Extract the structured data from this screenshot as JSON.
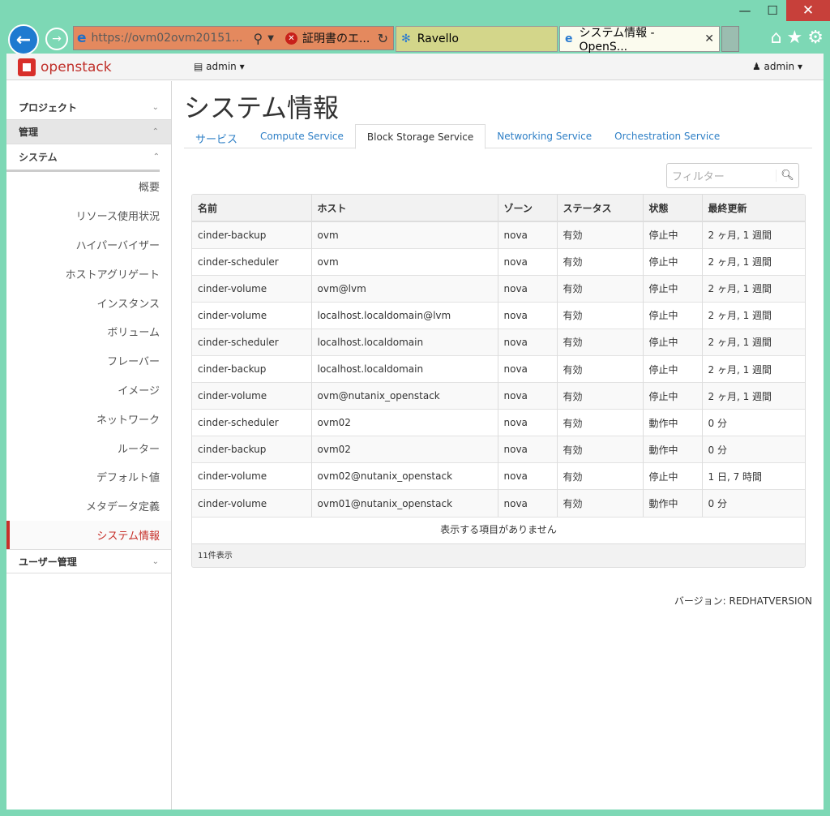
{
  "browser": {
    "address_url": "https://ovm02ovm20151...",
    "cert_error": "証明書のエ...",
    "tabs": [
      {
        "label": "Ravello"
      },
      {
        "label": "システム情報 - OpenS..."
      }
    ],
    "minimize": "—",
    "maximize": "☐",
    "close": "✕"
  },
  "topnav": {
    "brand": "openstack",
    "project": "admin",
    "user": "admin"
  },
  "sidebar": {
    "project_label": "プロジェクト",
    "admin_label": "管理",
    "system_label": "システム",
    "items": [
      "概要",
      "リソース使用状況",
      "ハイパーバイザー",
      "ホストアグリゲート",
      "インスタンス",
      "ボリューム",
      "フレーバー",
      "イメージ",
      "ネットワーク",
      "ルーター",
      "デフォルト値",
      "メタデータ定義",
      "システム情報"
    ],
    "user_mgmt_label": "ユーザー管理"
  },
  "main": {
    "title": "システム情報",
    "tabs": [
      "サービス",
      "Compute Service",
      "Block Storage Service",
      "Networking Service",
      "Orchestration Service"
    ],
    "filter_placeholder": "フィルター",
    "headers": [
      "名前",
      "ホスト",
      "ゾーン",
      "ステータス",
      "状態",
      "最終更新"
    ],
    "rows": [
      [
        "cinder-backup",
        "ovm",
        "nova",
        "有効",
        "停止中",
        "2 ヶ月, 1 週間"
      ],
      [
        "cinder-scheduler",
        "ovm",
        "nova",
        "有効",
        "停止中",
        "2 ヶ月, 1 週間"
      ],
      [
        "cinder-volume",
        "ovm@lvm",
        "nova",
        "有効",
        "停止中",
        "2 ヶ月, 1 週間"
      ],
      [
        "cinder-volume",
        "localhost.localdomain@lvm",
        "nova",
        "有効",
        "停止中",
        "2 ヶ月, 1 週間"
      ],
      [
        "cinder-scheduler",
        "localhost.localdomain",
        "nova",
        "有効",
        "停止中",
        "2 ヶ月, 1 週間"
      ],
      [
        "cinder-backup",
        "localhost.localdomain",
        "nova",
        "有効",
        "停止中",
        "2 ヶ月, 1 週間"
      ],
      [
        "cinder-volume",
        "ovm@nutanix_openstack",
        "nova",
        "有効",
        "停止中",
        "2 ヶ月, 1 週間"
      ],
      [
        "cinder-scheduler",
        "ovm02",
        "nova",
        "有効",
        "動作中",
        "0 分"
      ],
      [
        "cinder-backup",
        "ovm02",
        "nova",
        "有効",
        "動作中",
        "0 分"
      ],
      [
        "cinder-volume",
        "ovm02@nutanix_openstack",
        "nova",
        "有効",
        "停止中",
        "1 日, 7 時間"
      ],
      [
        "cinder-volume",
        "ovm01@nutanix_openstack",
        "nova",
        "有効",
        "動作中",
        "0 分"
      ]
    ],
    "empty_msg": "表示する項目がありません",
    "count_label": "11件表示",
    "version": "バージョン: REDHATVERSION"
  }
}
